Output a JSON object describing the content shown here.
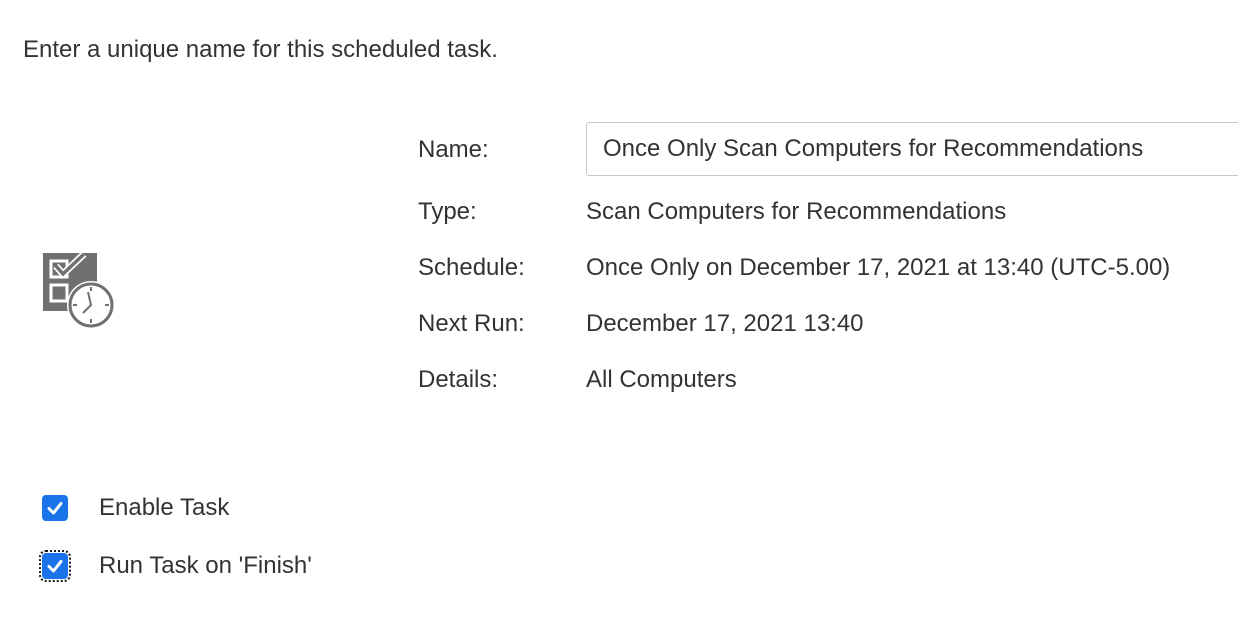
{
  "instruction": "Enter a unique name for this scheduled task.",
  "icon": "scheduled-task-icon",
  "fields": {
    "name_label": "Name:",
    "name_value": "Once Only Scan Computers for Recommendations",
    "type_label": "Type:",
    "type_value": "Scan Computers for Recommendations",
    "schedule_label": "Schedule:",
    "schedule_value": "Once Only on December 17, 2021 at 13:40 (UTC-5.00)",
    "next_run_label": "Next Run:",
    "next_run_value": "December 17, 2021 13:40",
    "details_label": "Details:",
    "details_value": "All Computers"
  },
  "options": {
    "enable_task": {
      "label": "Enable Task",
      "checked": true
    },
    "run_on_finish": {
      "label": "Run Task on 'Finish'",
      "checked": true
    }
  },
  "colors": {
    "checkbox": "#1a73e8",
    "text": "#333333",
    "icon": "#707070"
  }
}
